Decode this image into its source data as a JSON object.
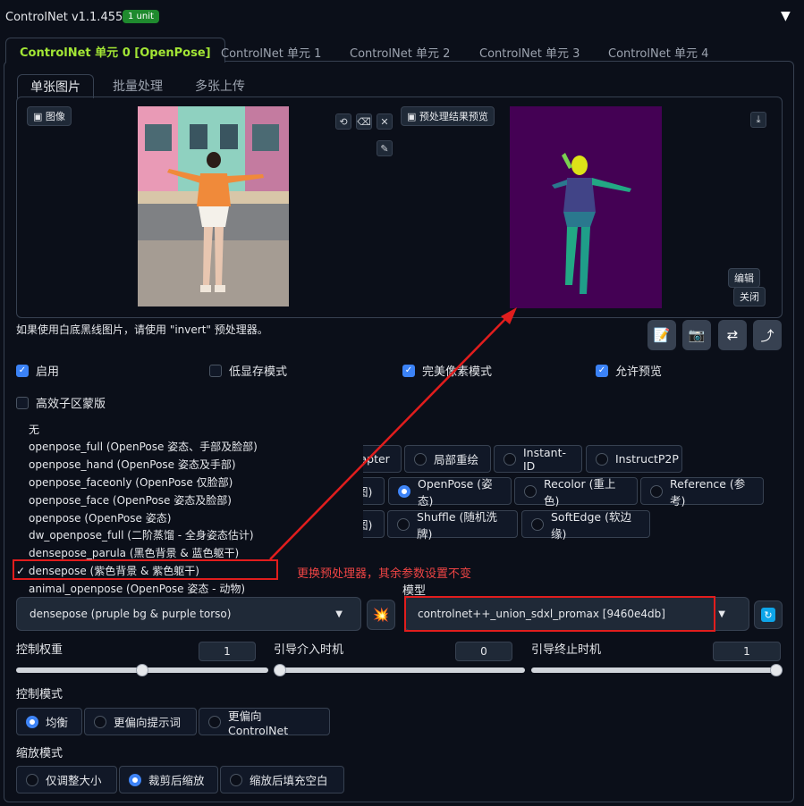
{
  "header": {
    "title": "ControlNet v1.1.455",
    "badge": "1 unit",
    "collapse_glyph": "▼"
  },
  "unit_tabs": [
    "ControlNet 单元 0 [OpenPose]",
    "ControlNet 单元 1",
    "ControlNet 单元 2",
    "ControlNet 单元 3",
    "ControlNet 单元 4"
  ],
  "sub_tabs": [
    "单张图片",
    "批量处理",
    "多张上传"
  ],
  "image_area": {
    "image_label": "图像",
    "preview_label": "预处理结果预览",
    "edit_label": "编辑",
    "close_label": "关闭",
    "hint": "如果使用白底黑线图片，请使用 \"invert\" 预处理器。"
  },
  "checkboxes": {
    "enable": "启用",
    "low_vram": "低显存模式",
    "pixel_perfect": "完美像素模式",
    "allow_preview": "允许预览",
    "effective_region_mask": "高效子区蒙版"
  },
  "preprocessor_dropdown": {
    "items": [
      "无",
      "openpose_full (OpenPose 姿态、手部及脸部)",
      "openpose_hand (OpenPose 姿态及手部)",
      "openpose_faceonly (OpenPose 仅脸部)",
      "openpose_face (OpenPose 姿态及脸部)",
      "openpose (OpenPose 姿态)",
      "dw_openpose_full (二阶蒸馏 - 全身姿态估计)",
      "densepose_parula (黑色背景 & 蓝色躯干)",
      "densepose (紫色背景 & 紫色躯干)",
      "animal_openpose (OpenPose 姿态 - 动物)"
    ],
    "selected_mark": "✓"
  },
  "control_types": {
    "row1": [
      "lapter",
      "局部重绘",
      "Instant-ID",
      "InstructP2P"
    ],
    "row2": [
      "图)",
      "OpenPose (姿态)",
      "Recolor (重上色)",
      "Reference (参考)"
    ],
    "row3": [
      "图)",
      "Shuffle (随机洗牌)",
      "SoftEdge (软边缘)"
    ]
  },
  "annotation": "更换预处理器，其余参数设置不变",
  "model_label": "模型",
  "preprocessor_value": "densepose (pruple bg & purple torso)",
  "model_value": "controlnet++_union_sdxl_promax [9460e4db]",
  "sliders": {
    "weight": {
      "label": "控制权重",
      "value": "1",
      "fraction": 0.5
    },
    "start": {
      "label": "引导介入时机",
      "value": "0",
      "fraction": 0.0
    },
    "end": {
      "label": "引导终止时机",
      "value": "1",
      "fraction": 1.0
    }
  },
  "control_mode": {
    "label": "控制模式",
    "options": [
      "均衡",
      "更偏向提示词",
      "更偏向 ControlNet"
    ],
    "selected": 0
  },
  "resize_mode": {
    "label": "缩放模式",
    "options": [
      "仅调整大小",
      "裁剪后缩放",
      "缩放后填充空白"
    ],
    "selected": 1
  },
  "colors": {
    "accent": "#a3e635",
    "blue": "#3b82f6",
    "red": "#e11d1d",
    "preview_bg": "#440154"
  }
}
